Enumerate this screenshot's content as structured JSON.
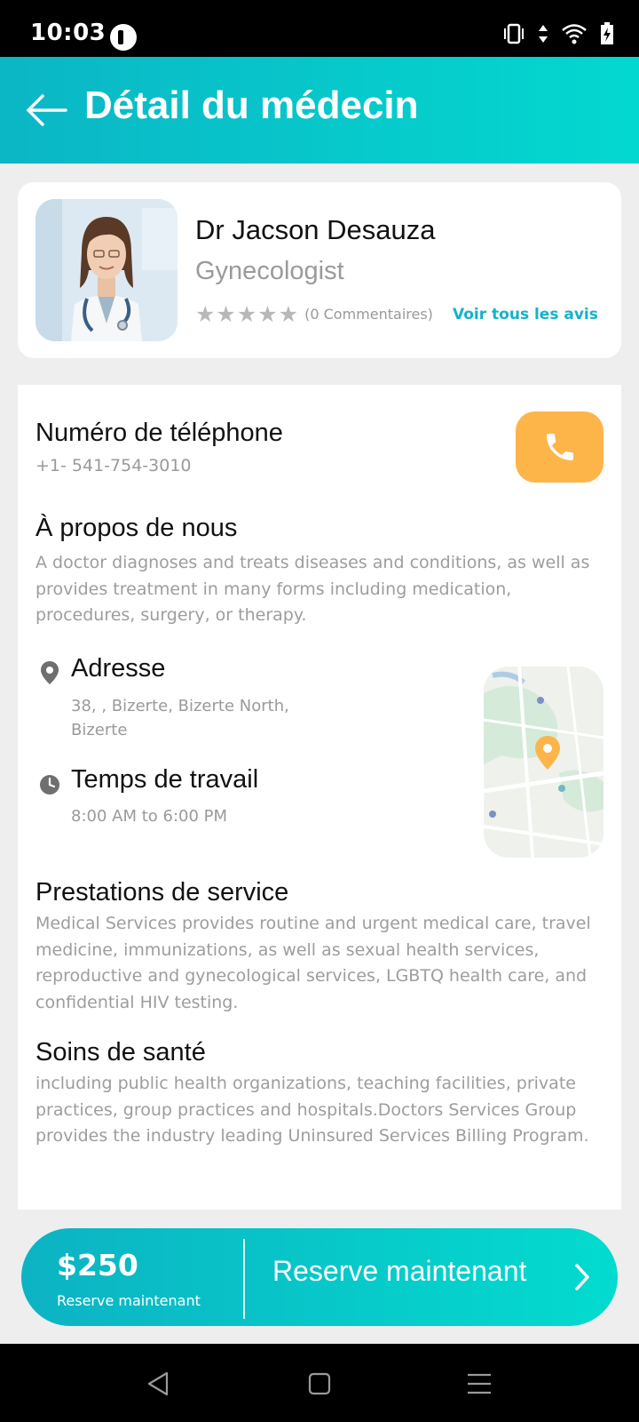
{
  "status_bar": {
    "time": "10:03"
  },
  "header": {
    "title": "Détail du médecin"
  },
  "doctor": {
    "name": "Dr Jacson Desauza",
    "specialty": "Gynecologist",
    "rating": 0,
    "rating_max": 5,
    "comments": "(0 Commentaires)",
    "see_reviews": "Voir tous les avis"
  },
  "phone": {
    "title": "Numéro de téléphone",
    "value": "+1- 541-754-3010"
  },
  "about": {
    "title": "À propos de nous",
    "text": "A doctor diagnoses and treats diseases and conditions, as well as provides treatment in many forms including medication, procedures, surgery, or therapy."
  },
  "address": {
    "title": "Adresse",
    "text": "38, , Bizerte, Bizerte North, Bizerte"
  },
  "work_time": {
    "title": "Temps de travail",
    "text": "8:00 AM to 6:00 PM"
  },
  "services": {
    "title": "Prestations de service",
    "text": "Medical Services provides routine and urgent medical care, travel medicine, immunizations, as well as sexual health services, reproductive and gynecological services, LGBTQ health care, and confidential HIV testing."
  },
  "healthcare": {
    "title": "Soins de santé",
    "text": "including public health organizations, teaching facilities, private practices, group practices and hospitals.Doctors Services Group provides the industry leading Uninsured Services Billing Program."
  },
  "booking": {
    "price": "$250",
    "price_sub": "Reserve maintenant",
    "button_label": "Reserve maintenant"
  },
  "colors": {
    "accent": "#0bb6c5",
    "call_button": "#fdb54a",
    "link": "#12b3c9"
  },
  "icons": {
    "back": "arrow-left-icon",
    "call": "phone-icon",
    "address": "location-pin-icon",
    "time": "clock-icon",
    "book": "chevron-right-icon"
  }
}
